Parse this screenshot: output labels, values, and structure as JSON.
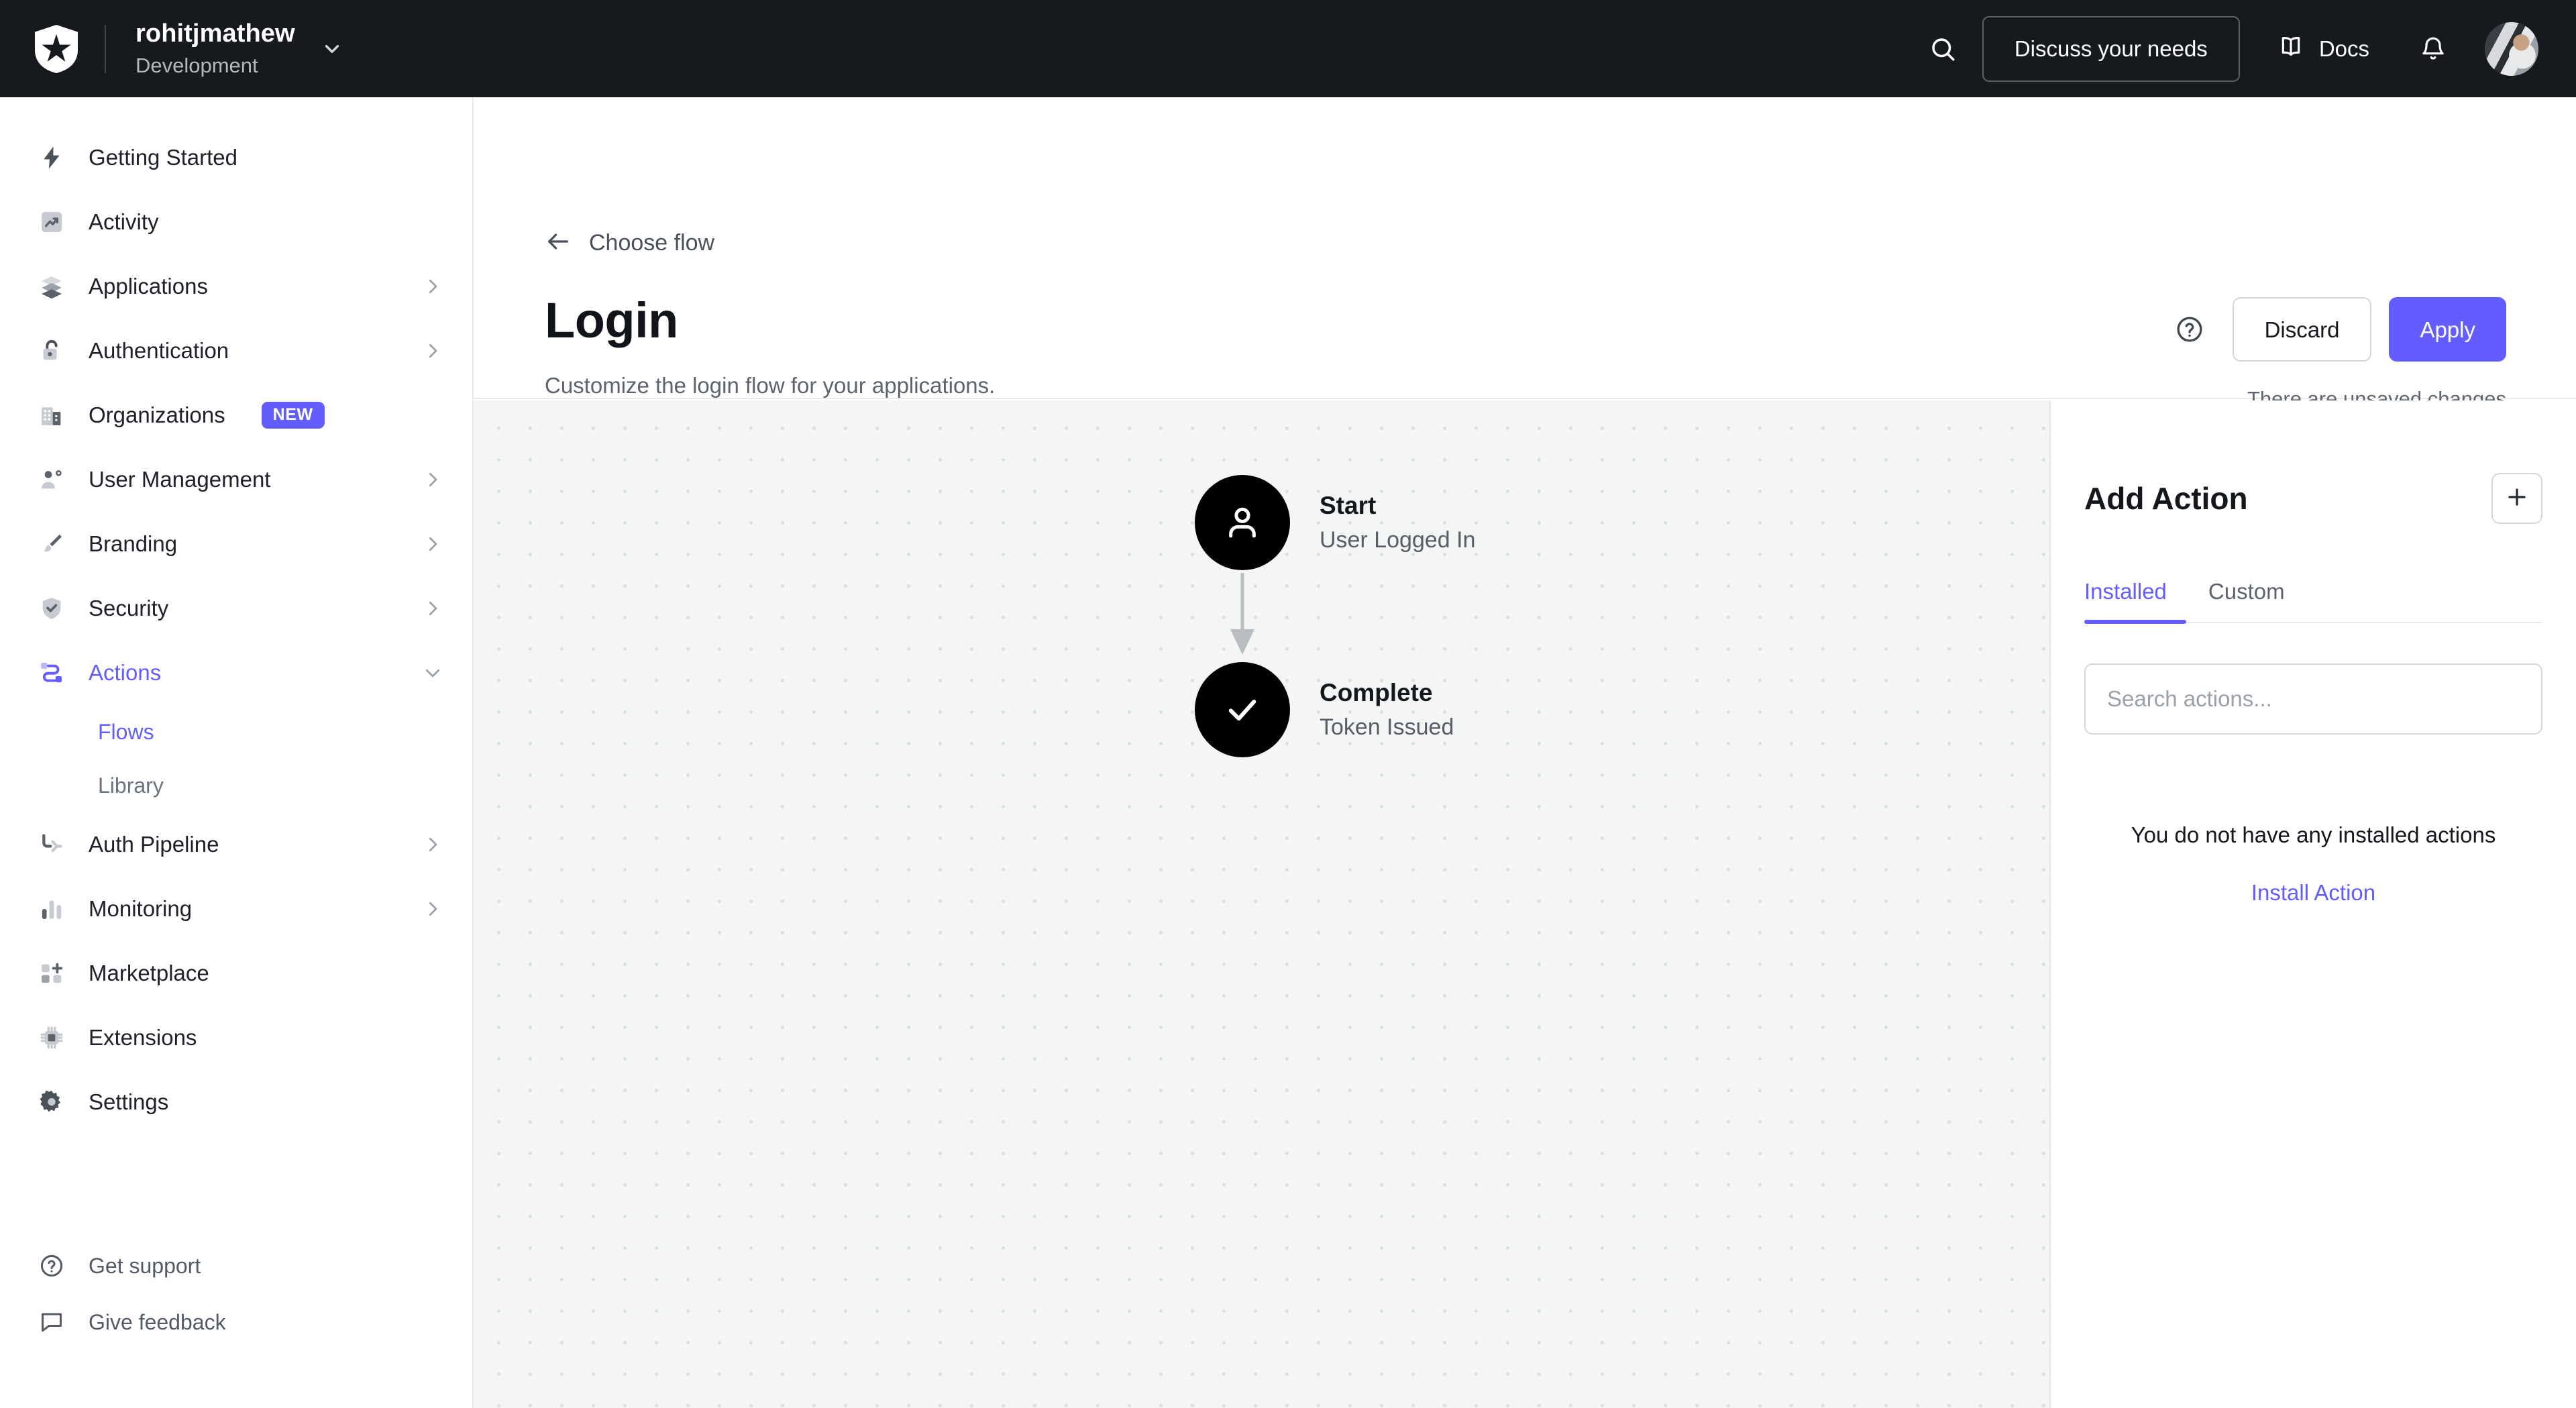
{
  "topbar": {
    "logo_icon": "auth0-shield-logo",
    "tenant_name": "rohitjmathew",
    "tenant_env": "Development",
    "tenant_caret_icon": "chevron-down-icon",
    "search_icon": "search-icon",
    "discuss_label": "Discuss your needs",
    "docs_icon": "book-icon",
    "docs_label": "Docs",
    "notifications_icon": "bell-icon",
    "avatar_icon": "user-avatar"
  },
  "sidebar": {
    "items": [
      {
        "label": "Getting Started",
        "icon": "lightning-bolt-icon",
        "chevron": "",
        "badge": ""
      },
      {
        "label": "Activity",
        "icon": "trending-up-icon",
        "chevron": "",
        "badge": ""
      },
      {
        "label": "Applications",
        "icon": "layers-icon",
        "chevron": "chevron-right-icon",
        "badge": ""
      },
      {
        "label": "Authentication",
        "icon": "lock-icon",
        "chevron": "chevron-right-icon",
        "badge": ""
      },
      {
        "label": "Organizations",
        "icon": "building-icon",
        "chevron": "",
        "badge": "NEW"
      },
      {
        "label": "User Management",
        "icon": "user-gear-icon",
        "chevron": "chevron-right-icon",
        "badge": ""
      },
      {
        "label": "Branding",
        "icon": "paintbrush-icon",
        "chevron": "chevron-right-icon",
        "badge": ""
      },
      {
        "label": "Security",
        "icon": "shield-check-icon",
        "chevron": "chevron-right-icon",
        "badge": ""
      },
      {
        "label": "Actions",
        "icon": "actions-flow-icon",
        "chevron": "chevron-down-icon",
        "badge": ""
      }
    ],
    "actions_subitems": [
      {
        "label": "Flows"
      },
      {
        "label": "Library"
      }
    ],
    "items_after": [
      {
        "label": "Auth Pipeline",
        "icon": "pipeline-icon",
        "chevron": "chevron-right-icon",
        "badge": ""
      },
      {
        "label": "Monitoring",
        "icon": "bar-chart-icon",
        "chevron": "chevron-right-icon",
        "badge": ""
      },
      {
        "label": "Marketplace",
        "icon": "grid-plus-icon",
        "chevron": "",
        "badge": ""
      },
      {
        "label": "Extensions",
        "icon": "chip-icon",
        "chevron": "",
        "badge": ""
      },
      {
        "label": "Settings",
        "icon": "gear-icon",
        "chevron": "",
        "badge": ""
      }
    ],
    "bottom_items": [
      {
        "label": "Get support",
        "icon": "question-circle-icon"
      },
      {
        "label": "Give feedback",
        "icon": "speech-bubble-icon"
      }
    ]
  },
  "page": {
    "back_icon": "arrow-left-icon",
    "back_label": "Choose flow",
    "title": "Login",
    "subtitle": "Customize the login flow for your applications.",
    "help_icon": "question-circle-icon",
    "discard_label": "Discard",
    "apply_label": "Apply",
    "unsaved_label": "There are unsaved changes"
  },
  "flow": {
    "start": {
      "icon": "person-icon",
      "title": "Start",
      "subtitle": "User Logged In"
    },
    "connector_icon": "arrow-down-icon",
    "complete": {
      "icon": "check-icon",
      "title": "Complete",
      "subtitle": "Token Issued"
    }
  },
  "right_panel": {
    "title": "Add Action",
    "add_icon": "plus-icon",
    "tabs": [
      {
        "label": "Installed",
        "active": true
      },
      {
        "label": "Custom",
        "active": false
      }
    ],
    "search_placeholder": "Search actions...",
    "empty_message": "You do not have any installed actions",
    "empty_link": "Install Action"
  },
  "colors": {
    "accent": "#635DFF",
    "topbar_bg": "#16191D",
    "canvas_bg": "#F4F6F6",
    "node_bg": "#000000",
    "border": "#E6E8EA"
  }
}
